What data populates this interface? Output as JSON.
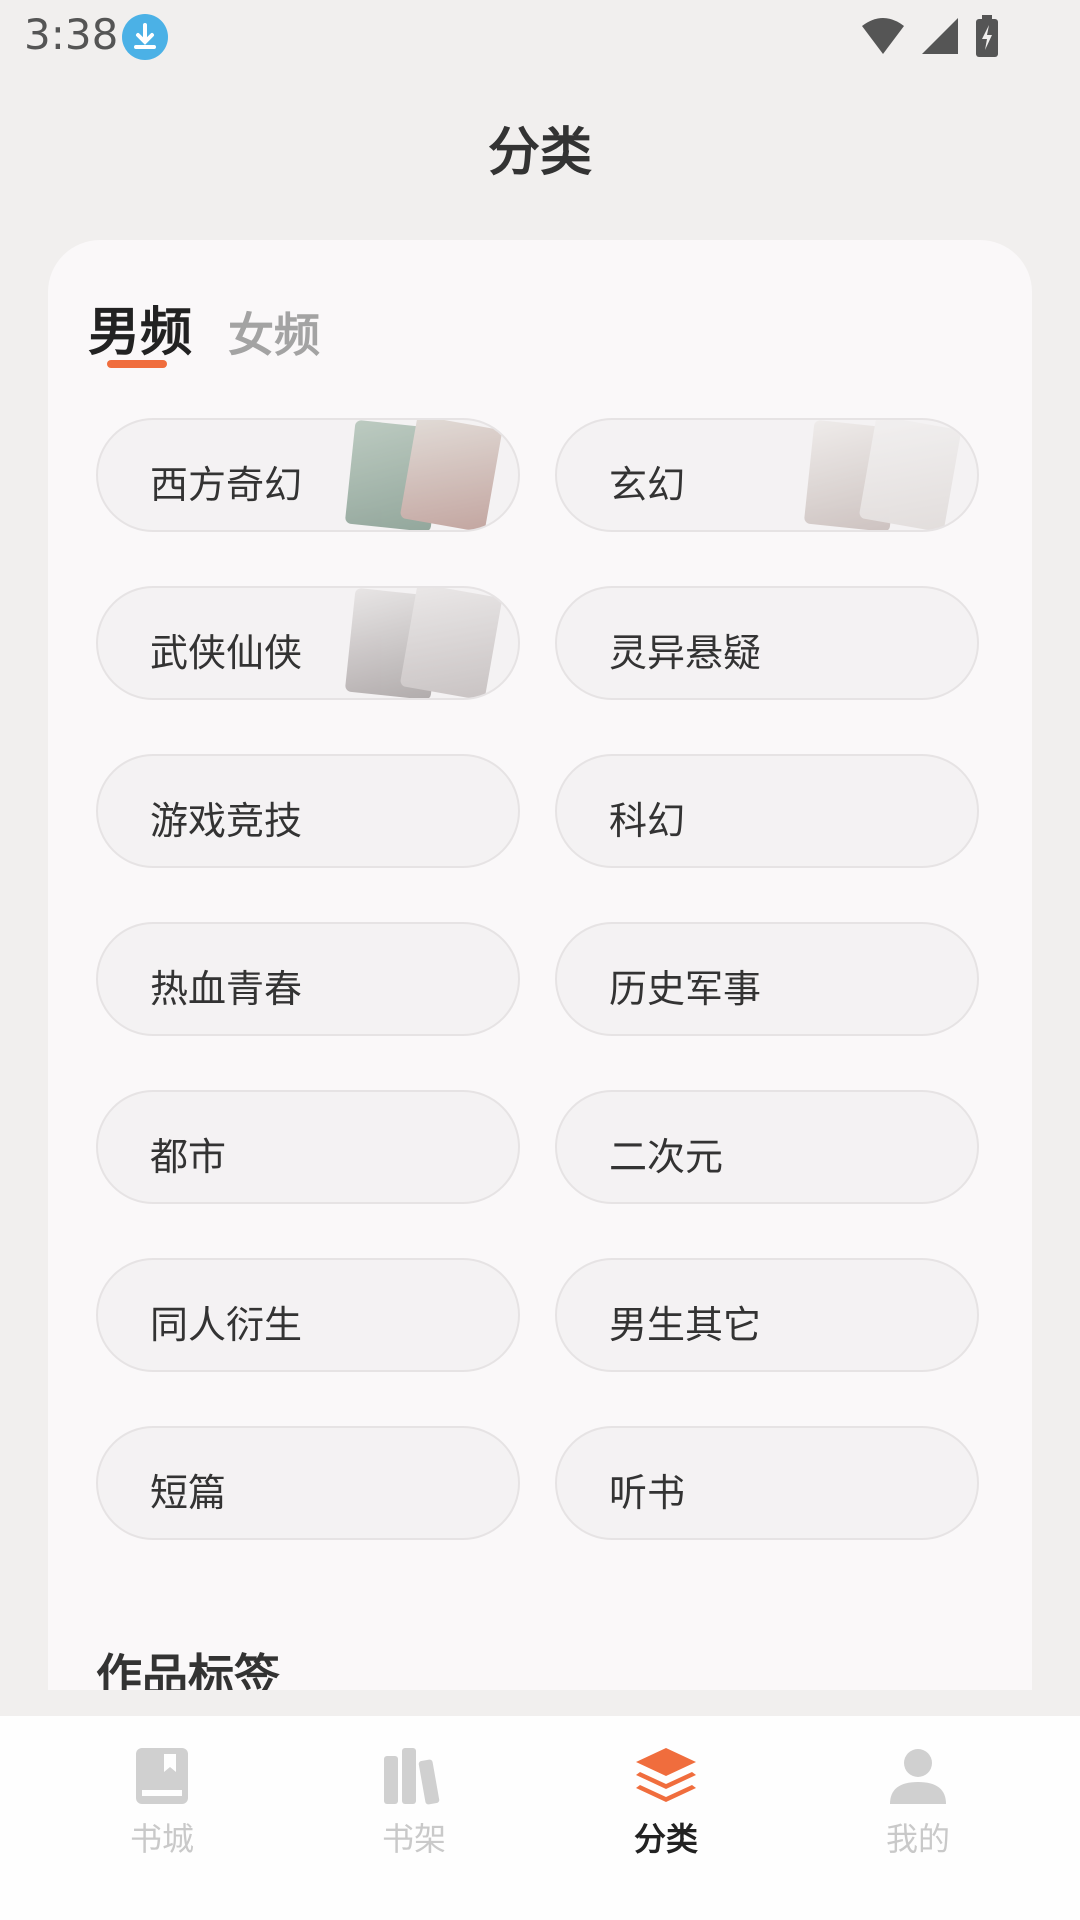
{
  "status_bar": {
    "time": "3:38"
  },
  "header": {
    "title": "分类"
  },
  "tabs": [
    {
      "label": "男频",
      "active": true
    },
    {
      "label": "女频",
      "active": false
    }
  ],
  "categories": [
    {
      "label": "西方奇幻",
      "has_cover": true
    },
    {
      "label": "玄幻",
      "has_cover": true
    },
    {
      "label": "武侠仙侠",
      "has_cover": true
    },
    {
      "label": "灵异悬疑",
      "has_cover": false
    },
    {
      "label": "游戏竞技",
      "has_cover": false
    },
    {
      "label": "科幻",
      "has_cover": false
    },
    {
      "label": "热血青春",
      "has_cover": false
    },
    {
      "label": "历史军事",
      "has_cover": false
    },
    {
      "label": "都市",
      "has_cover": false
    },
    {
      "label": "二次元",
      "has_cover": false
    },
    {
      "label": "同人衍生",
      "has_cover": false
    },
    {
      "label": "男生其它",
      "has_cover": false
    },
    {
      "label": "短篇",
      "has_cover": false
    },
    {
      "label": "听书",
      "has_cover": false
    }
  ],
  "section": {
    "title": "作品标签"
  },
  "bottom_nav": [
    {
      "label": "书城",
      "icon": "book-icon",
      "active": false
    },
    {
      "label": "书架",
      "icon": "bookshelf-icon",
      "active": false
    },
    {
      "label": "分类",
      "icon": "layers-icon",
      "active": true
    },
    {
      "label": "我的",
      "icon": "user-icon",
      "active": false
    }
  ],
  "colors": {
    "accent": "#f06d3d",
    "inactive_nav": "#c9c9c9",
    "background": "#f1efee"
  }
}
